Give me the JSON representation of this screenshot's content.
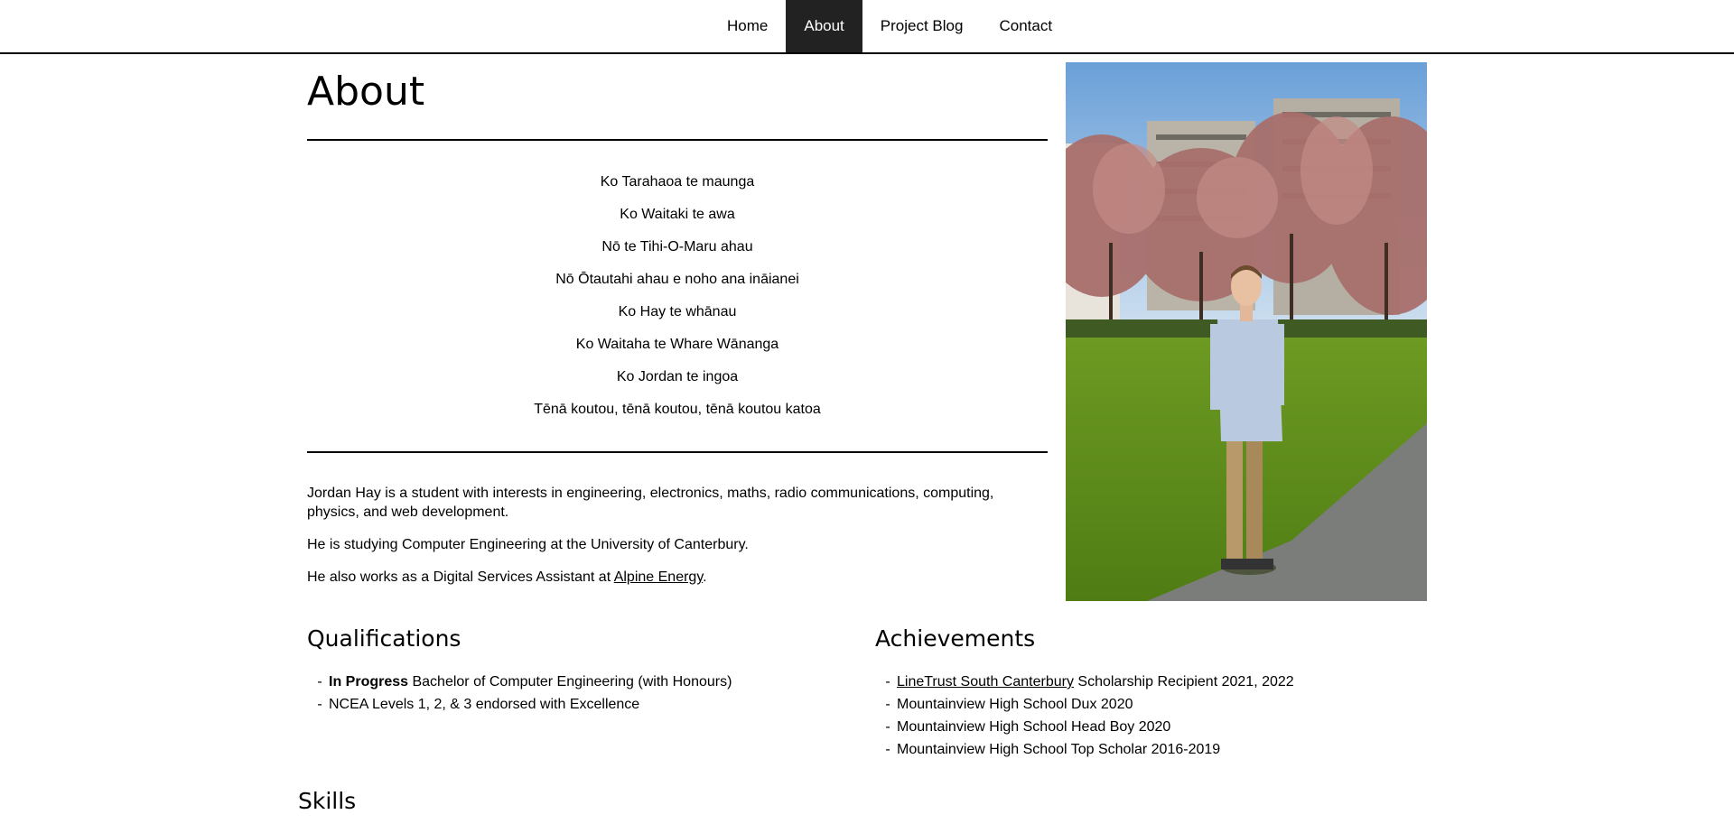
{
  "nav": {
    "items": [
      {
        "label": "Home",
        "active": false
      },
      {
        "label": "About",
        "active": true
      },
      {
        "label": "Project Blog",
        "active": false
      },
      {
        "label": "Contact",
        "active": false
      }
    ]
  },
  "about": {
    "title": "About",
    "pepeha": [
      "Ko Tarahaoa te maunga",
      "Ko Waitaki te awa",
      "Nō te Tihi-O-Maru ahau",
      "Nō Ōtautahi ahau e noho ana ināianei",
      "Ko Hay te whānau",
      "Ko Waitaha te Whare Wānanga",
      "Ko Jordan te ingoa",
      "Tēnā koutou, tēnā koutou, tēnā koutou katoa"
    ],
    "bio": {
      "p1": "Jordan Hay is a student with interests in engineering, electronics, maths, radio communications, computing, physics, and web development.",
      "p2": "He is studying Computer Engineering at the University of Canterbury.",
      "p3_prefix": "He also works as a Digital Services Assistant at ",
      "p3_link": "Alpine Energy",
      "p3_suffix": "."
    }
  },
  "qualifications": {
    "title": "Qualifications",
    "items": [
      {
        "bold": "In Progress",
        "text": " Bachelor of Computer Engineering (with Honours)"
      },
      {
        "bold": "",
        "text": "NCEA Levels 1, 2, & 3 endorsed with Excellence"
      }
    ]
  },
  "achievements": {
    "title": "Achievements",
    "items": [
      {
        "link": "LineTrust South Canterbury",
        "text": " Scholarship Recipient 2021, 2022"
      },
      {
        "link": "",
        "text": "Mountainview High School Dux 2020"
      },
      {
        "link": "",
        "text": "Mountainview High School Head Boy 2020"
      },
      {
        "link": "",
        "text": "Mountainview High School Top Scholar 2016-2019"
      }
    ]
  },
  "skills": {
    "title": "Skills"
  },
  "colors": {
    "nav_active_bg": "#222222",
    "text": "#000000",
    "background": "#ffffff"
  }
}
